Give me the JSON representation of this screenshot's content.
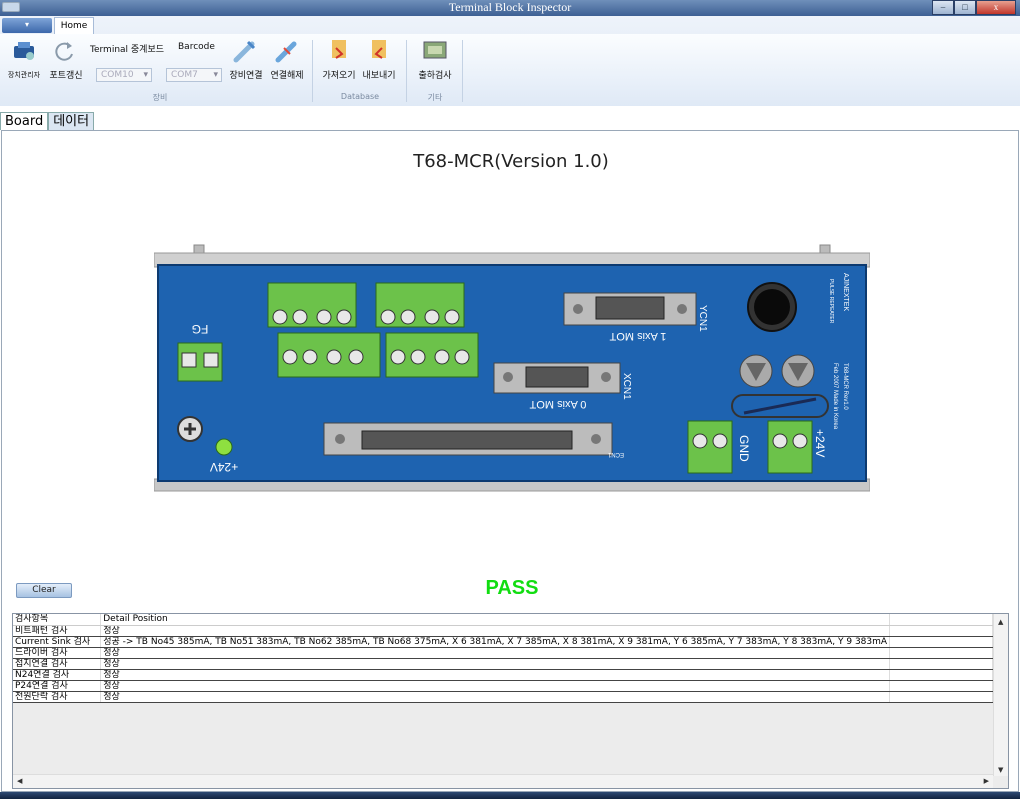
{
  "window": {
    "title": "Terminal Block Inspector",
    "min": "–",
    "max": "□",
    "close": "x"
  },
  "ribbon": {
    "tab_home": "Home",
    "device_manager": "장치관리자",
    "port_refresh": "포트갱신",
    "terminal_label": "Terminal 중계보드",
    "terminal_value": "COM10",
    "barcode_label": "Barcode",
    "barcode_value": "COM7",
    "connect": "장비연결",
    "disconnect": "연결해제",
    "group_device": "장비",
    "import": "가져오기",
    "export": "내보내기",
    "group_database": "Database",
    "ship_inspect": "출하검사",
    "group_etc": "기타"
  },
  "tabs": [
    "Board",
    "데이터"
  ],
  "board": {
    "title": "T68-MCR(Version 1.0)",
    "labels": {
      "fg": "FG",
      "p24_left": "+24V",
      "gnd": "GND",
      "p24_right": "+24V",
      "ycn1": "YCN1",
      "xcn1": "XCN1",
      "ecn1": "ECN1",
      "axis1": "1 Axis MOT",
      "axis0": "0 Axis MOT",
      "brand": "AJINEXTEK",
      "model": "T68-MCR Rev1.0",
      "date": "Feb 2007 Made in Korea",
      "pulse": "PULSE REPEATER"
    }
  },
  "clear_button": "Clear",
  "result": {
    "text": "PASS",
    "color": "#11dd11"
  },
  "grid": {
    "headers": [
      "검사항목",
      "Detail Position"
    ],
    "rows": [
      [
        "비트패턴 검사",
        "정상"
      ],
      [
        "Current Sink 검사",
        "성공   ->   TB No45 385mA, TB No51 383mA, TB No62 385mA, TB No68 375mA, X 6 381mA, X 7 385mA, X 8 381mA, X 9 381mA, Y 6 385mA, Y 7 383mA, Y 8 383mA, Y 9 383mA"
      ],
      [
        "드라이버 검사",
        "정상"
      ],
      [
        "접지연결 검사",
        "정상"
      ],
      [
        "N24연결 검사",
        "정상"
      ],
      [
        "P24연결 검사",
        "정상"
      ],
      [
        "전원단락 검사",
        "정상"
      ]
    ]
  },
  "colors": {
    "board_blue": "#1e63b0",
    "terminal_green": "#6cc24a",
    "pass_green": "#11dd11"
  }
}
